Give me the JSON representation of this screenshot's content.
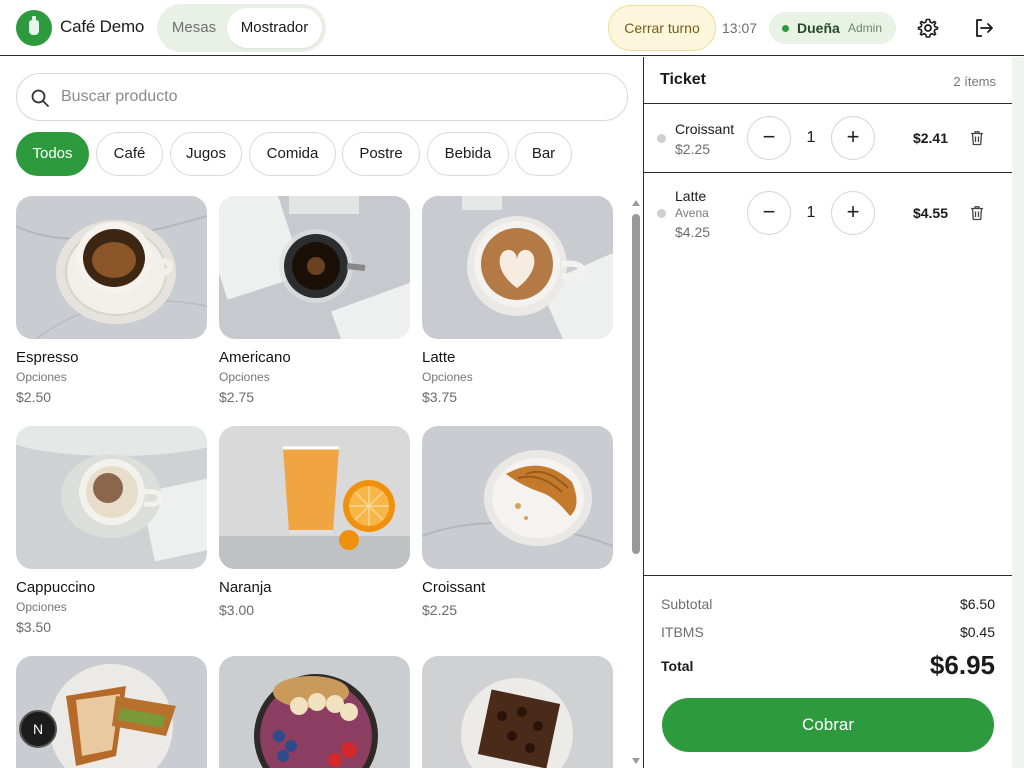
{
  "header": {
    "brand": "Café Demo",
    "tabs": [
      {
        "label": "Mesas",
        "active": false
      },
      {
        "label": "Mostrador",
        "active": true
      }
    ],
    "close_shift_label": "Cerrar turno",
    "time": "13:07",
    "user": {
      "name": "Dueña",
      "role": "Admin",
      "status_color": "#2e9a3e"
    },
    "settings_icon": "gear-icon",
    "logout_icon": "logout-icon"
  },
  "search": {
    "placeholder": "Buscar producto",
    "value": ""
  },
  "categories": [
    {
      "label": "Todos",
      "active": true
    },
    {
      "label": "Café",
      "active": false
    },
    {
      "label": "Jugos",
      "active": false
    },
    {
      "label": "Comida",
      "active": false
    },
    {
      "label": "Postre",
      "active": false
    },
    {
      "label": "Bebida",
      "active": false
    },
    {
      "label": "Bar",
      "active": false
    }
  ],
  "products": [
    {
      "name": "Espresso",
      "options": "Opciones",
      "price": "$2.50"
    },
    {
      "name": "Americano",
      "options": "Opciones",
      "price": "$2.75"
    },
    {
      "name": "Latte",
      "options": "Opciones",
      "price": "$3.75"
    },
    {
      "name": "Cappuccino",
      "options": "Opciones",
      "price": "$3.50"
    },
    {
      "name": "Naranja",
      "options": "",
      "price": "$3.00"
    },
    {
      "name": "Croissant",
      "options": "",
      "price": "$2.25"
    },
    {
      "name": "",
      "options": "",
      "price": ""
    },
    {
      "name": "",
      "options": "",
      "price": ""
    },
    {
      "name": "",
      "options": "",
      "price": ""
    }
  ],
  "badge": "N",
  "ticket": {
    "title": "Ticket",
    "count": "2 ítems",
    "lines": [
      {
        "name": "Croissant",
        "modifier": "",
        "unit_price": "$2.25",
        "qty": "1",
        "total": "$2.41"
      },
      {
        "name": "Latte",
        "modifier": "Avena",
        "unit_price": "$4.25",
        "qty": "1",
        "total": "$4.55"
      }
    ],
    "subtotal_label": "Subtotal",
    "subtotal": "$6.50",
    "tax_label": "ITBMS",
    "tax": "$0.45",
    "total_label": "Total",
    "total": "$6.95",
    "charge_label": "Cobrar"
  },
  "colors": {
    "accent": "#2e9a3e",
    "shift_bg": "#fdf6dc"
  }
}
